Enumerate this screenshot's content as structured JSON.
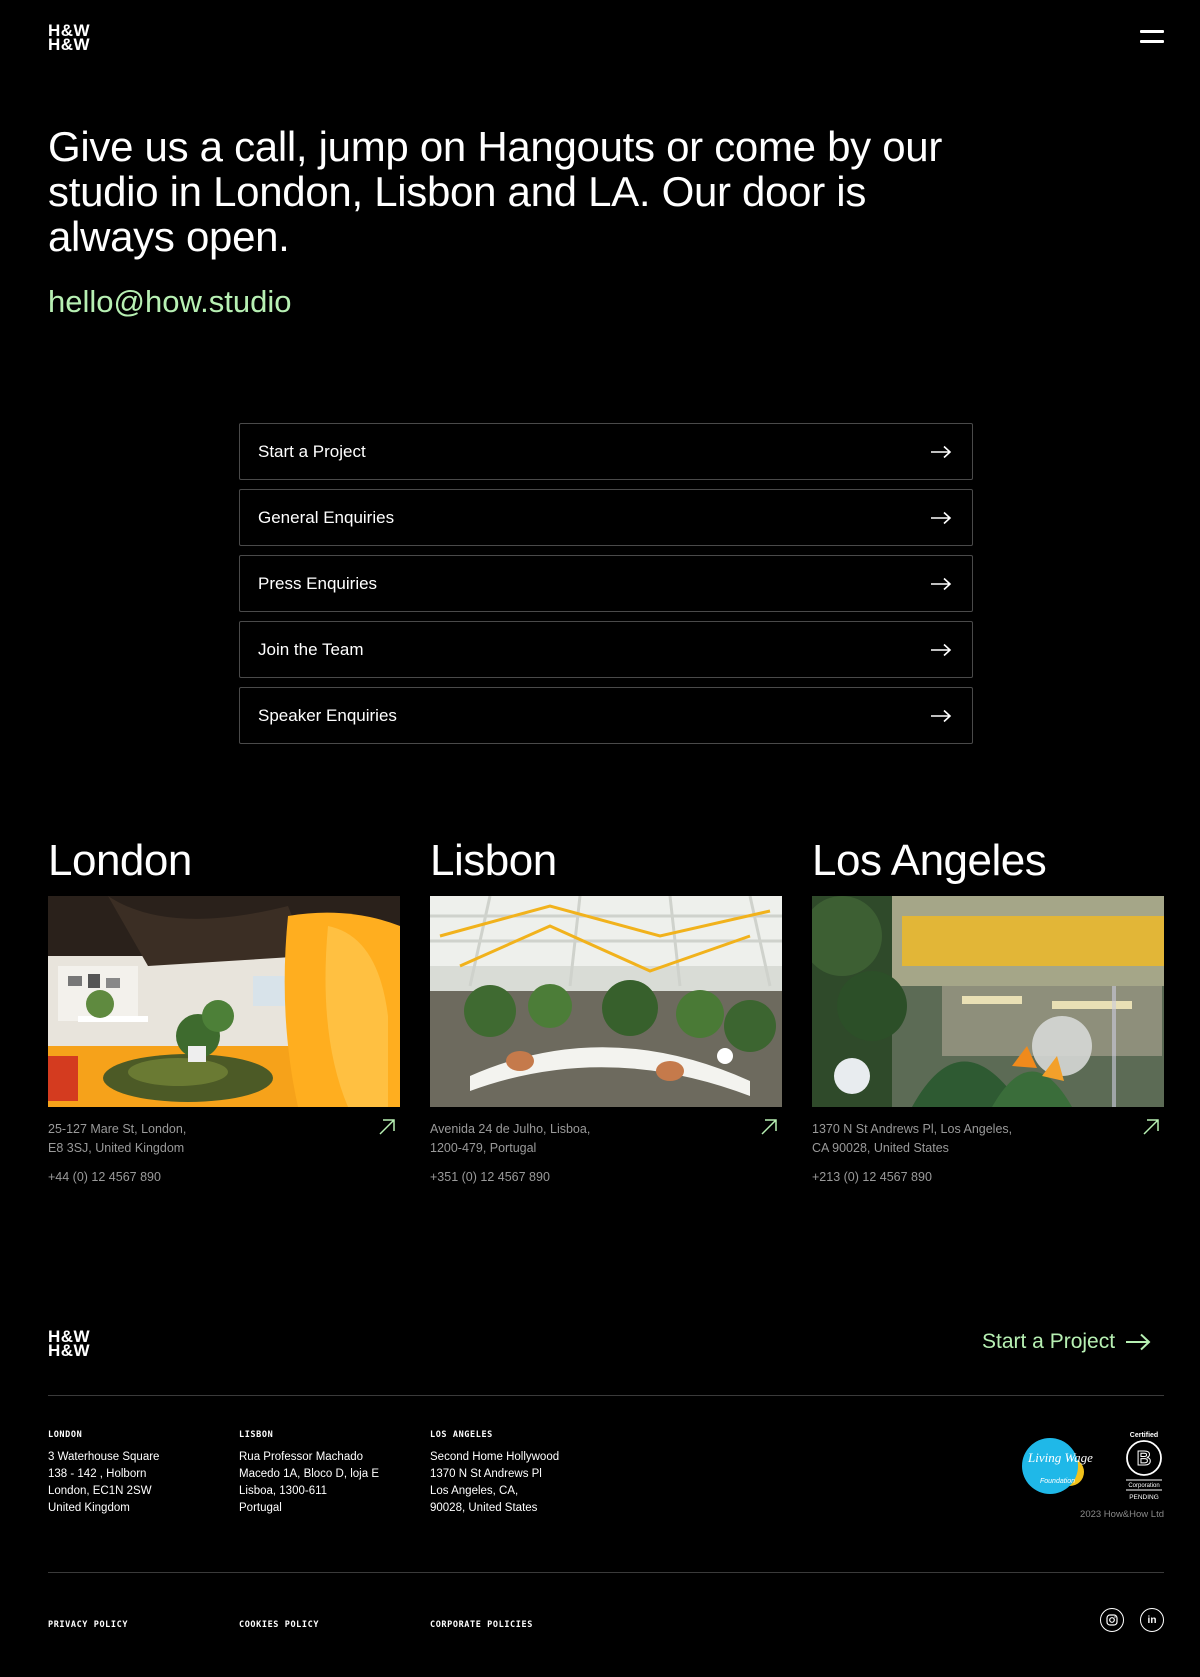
{
  "header": {
    "logo_line1": "H&W",
    "logo_line2": "H&W",
    "menu_icon": "hamburger-icon"
  },
  "hero": {
    "heading": "Give us a call, jump on Hangouts or come by our studio in London, Lisbon and LA. Our door is always open.",
    "email": "hello@how.studio"
  },
  "enquiries": [
    {
      "label": "Start a Project",
      "icon": "arrow-right-icon"
    },
    {
      "label": "General Enquiries",
      "icon": "arrow-right-icon"
    },
    {
      "label": "Press Enquiries",
      "icon": "arrow-right-icon"
    },
    {
      "label": "Join the Team",
      "icon": "arrow-right-icon"
    },
    {
      "label": "Speaker Enquiries",
      "icon": "arrow-right-icon"
    }
  ],
  "offices": [
    {
      "city": "London",
      "address_line1": "25-127 Mare St, London,",
      "address_line2": "E8 3SJ, United Kingdom",
      "phone": "+44 (0) 12 4567 890",
      "icon": "arrow-up-right-icon"
    },
    {
      "city": "Lisbon",
      "address_line1": "Avenida 24 de Julho, Lisboa,",
      "address_line2": "1200-479, Portugal",
      "phone": "+351 (0) 12 4567 890",
      "icon": "arrow-up-right-icon"
    },
    {
      "city": "Los Angeles",
      "address_line1": "1370 N St Andrews Pl, Los Angeles,",
      "address_line2": "CA 90028, United States",
      "phone": "+213 (0) 12 4567 890",
      "icon": "arrow-up-right-icon"
    }
  ],
  "footer": {
    "cta": "Start a Project",
    "columns": [
      {
        "heading": "LONDON",
        "lines": [
          "3 Waterhouse Square",
          "138 - 142 , Holborn",
          "London, EC1N 2SW",
          "United Kingdom"
        ]
      },
      {
        "heading": "LISBON",
        "lines": [
          "Rua Professor Machado",
          "Macedo 1A, Bloco D, loja E",
          "Lisboa, 1300-611",
          "Portugal"
        ]
      },
      {
        "heading": "LOS ANGELES",
        "lines": [
          "Second Home Hollywood",
          "1370 N St Andrews Pl",
          "Los Angeles, CA,",
          "90028, United States"
        ]
      }
    ],
    "badges": {
      "living_wage": "Living Wage",
      "living_wage_sub": "Foundation",
      "bcorp_top": "Certified",
      "bcorp_letter": "B",
      "bcorp_sub": "Corporation",
      "bcorp_status": "PENDING"
    },
    "copyright": "2023 How&How Ltd",
    "legal": [
      "PRIVACY POLICY",
      "COOKIES POLICY",
      "CORPORATE POLICIES"
    ],
    "social": [
      {
        "icon": "instagram-icon"
      },
      {
        "icon": "linkedin-icon",
        "label": "in"
      }
    ]
  },
  "colors": {
    "accent": "#b7f0b3",
    "background": "#000000",
    "muted_text": "#9a9a9a",
    "border": "#4a4a4a"
  }
}
